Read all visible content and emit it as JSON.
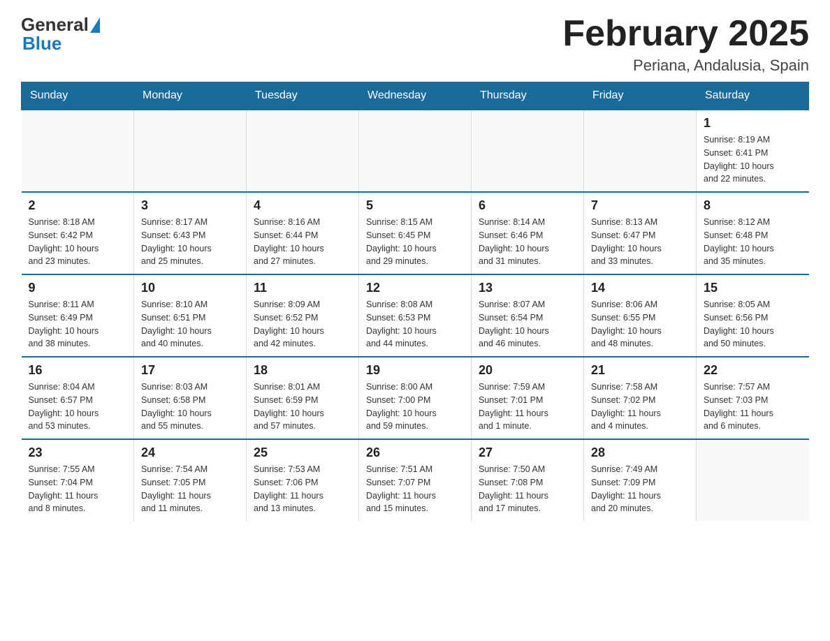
{
  "header": {
    "logo_general": "General",
    "logo_blue": "Blue",
    "title": "February 2025",
    "subtitle": "Periana, Andalusia, Spain"
  },
  "weekdays": [
    "Sunday",
    "Monday",
    "Tuesday",
    "Wednesday",
    "Thursday",
    "Friday",
    "Saturday"
  ],
  "weeks": [
    [
      {
        "day": "",
        "info": ""
      },
      {
        "day": "",
        "info": ""
      },
      {
        "day": "",
        "info": ""
      },
      {
        "day": "",
        "info": ""
      },
      {
        "day": "",
        "info": ""
      },
      {
        "day": "",
        "info": ""
      },
      {
        "day": "1",
        "info": "Sunrise: 8:19 AM\nSunset: 6:41 PM\nDaylight: 10 hours\nand 22 minutes."
      }
    ],
    [
      {
        "day": "2",
        "info": "Sunrise: 8:18 AM\nSunset: 6:42 PM\nDaylight: 10 hours\nand 23 minutes."
      },
      {
        "day": "3",
        "info": "Sunrise: 8:17 AM\nSunset: 6:43 PM\nDaylight: 10 hours\nand 25 minutes."
      },
      {
        "day": "4",
        "info": "Sunrise: 8:16 AM\nSunset: 6:44 PM\nDaylight: 10 hours\nand 27 minutes."
      },
      {
        "day": "5",
        "info": "Sunrise: 8:15 AM\nSunset: 6:45 PM\nDaylight: 10 hours\nand 29 minutes."
      },
      {
        "day": "6",
        "info": "Sunrise: 8:14 AM\nSunset: 6:46 PM\nDaylight: 10 hours\nand 31 minutes."
      },
      {
        "day": "7",
        "info": "Sunrise: 8:13 AM\nSunset: 6:47 PM\nDaylight: 10 hours\nand 33 minutes."
      },
      {
        "day": "8",
        "info": "Sunrise: 8:12 AM\nSunset: 6:48 PM\nDaylight: 10 hours\nand 35 minutes."
      }
    ],
    [
      {
        "day": "9",
        "info": "Sunrise: 8:11 AM\nSunset: 6:49 PM\nDaylight: 10 hours\nand 38 minutes."
      },
      {
        "day": "10",
        "info": "Sunrise: 8:10 AM\nSunset: 6:51 PM\nDaylight: 10 hours\nand 40 minutes."
      },
      {
        "day": "11",
        "info": "Sunrise: 8:09 AM\nSunset: 6:52 PM\nDaylight: 10 hours\nand 42 minutes."
      },
      {
        "day": "12",
        "info": "Sunrise: 8:08 AM\nSunset: 6:53 PM\nDaylight: 10 hours\nand 44 minutes."
      },
      {
        "day": "13",
        "info": "Sunrise: 8:07 AM\nSunset: 6:54 PM\nDaylight: 10 hours\nand 46 minutes."
      },
      {
        "day": "14",
        "info": "Sunrise: 8:06 AM\nSunset: 6:55 PM\nDaylight: 10 hours\nand 48 minutes."
      },
      {
        "day": "15",
        "info": "Sunrise: 8:05 AM\nSunset: 6:56 PM\nDaylight: 10 hours\nand 50 minutes."
      }
    ],
    [
      {
        "day": "16",
        "info": "Sunrise: 8:04 AM\nSunset: 6:57 PM\nDaylight: 10 hours\nand 53 minutes."
      },
      {
        "day": "17",
        "info": "Sunrise: 8:03 AM\nSunset: 6:58 PM\nDaylight: 10 hours\nand 55 minutes."
      },
      {
        "day": "18",
        "info": "Sunrise: 8:01 AM\nSunset: 6:59 PM\nDaylight: 10 hours\nand 57 minutes."
      },
      {
        "day": "19",
        "info": "Sunrise: 8:00 AM\nSunset: 7:00 PM\nDaylight: 10 hours\nand 59 minutes."
      },
      {
        "day": "20",
        "info": "Sunrise: 7:59 AM\nSunset: 7:01 PM\nDaylight: 11 hours\nand 1 minute."
      },
      {
        "day": "21",
        "info": "Sunrise: 7:58 AM\nSunset: 7:02 PM\nDaylight: 11 hours\nand 4 minutes."
      },
      {
        "day": "22",
        "info": "Sunrise: 7:57 AM\nSunset: 7:03 PM\nDaylight: 11 hours\nand 6 minutes."
      }
    ],
    [
      {
        "day": "23",
        "info": "Sunrise: 7:55 AM\nSunset: 7:04 PM\nDaylight: 11 hours\nand 8 minutes."
      },
      {
        "day": "24",
        "info": "Sunrise: 7:54 AM\nSunset: 7:05 PM\nDaylight: 11 hours\nand 11 minutes."
      },
      {
        "day": "25",
        "info": "Sunrise: 7:53 AM\nSunset: 7:06 PM\nDaylight: 11 hours\nand 13 minutes."
      },
      {
        "day": "26",
        "info": "Sunrise: 7:51 AM\nSunset: 7:07 PM\nDaylight: 11 hours\nand 15 minutes."
      },
      {
        "day": "27",
        "info": "Sunrise: 7:50 AM\nSunset: 7:08 PM\nDaylight: 11 hours\nand 17 minutes."
      },
      {
        "day": "28",
        "info": "Sunrise: 7:49 AM\nSunset: 7:09 PM\nDaylight: 11 hours\nand 20 minutes."
      },
      {
        "day": "",
        "info": ""
      }
    ]
  ]
}
